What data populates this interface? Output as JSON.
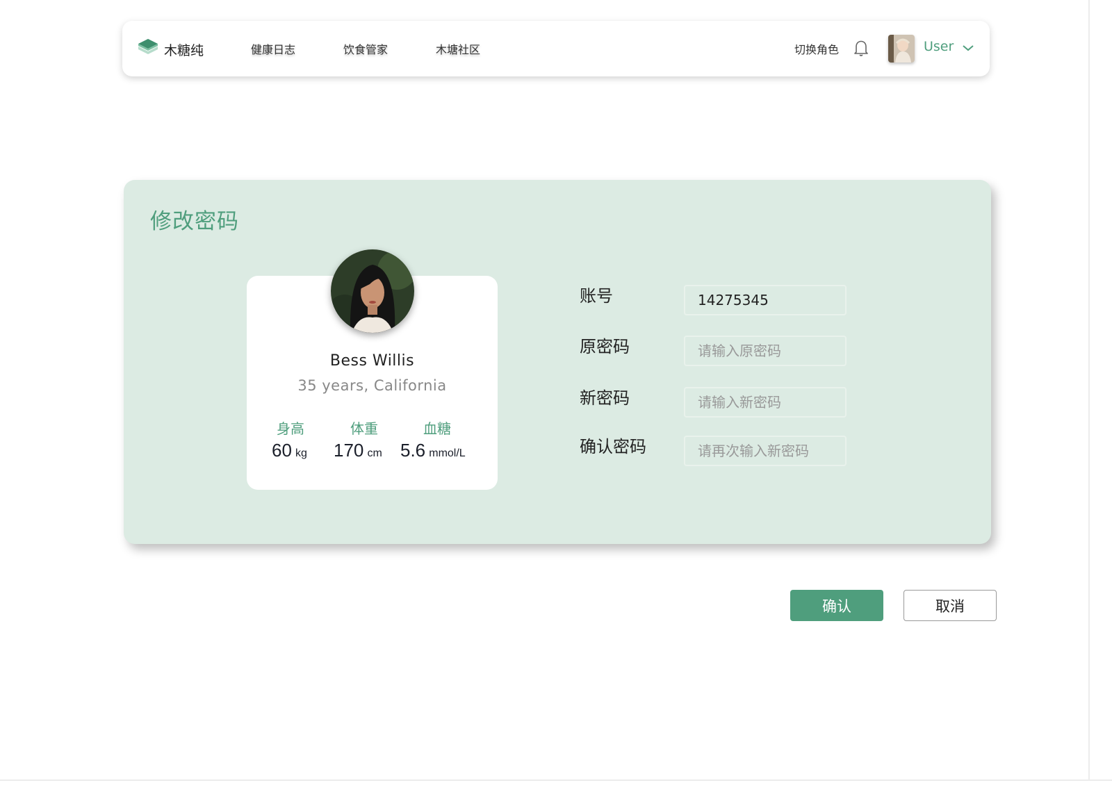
{
  "nav": {
    "brand": "木糖纯",
    "links": [
      "健康日志",
      "饮食管家",
      "木塘社区"
    ],
    "switch_role": "切换角色",
    "user_name": "User"
  },
  "panel": {
    "title": "修改密码"
  },
  "profile": {
    "name": "Bess Willis",
    "subtitle": "35 years, California",
    "stats": [
      {
        "label": "身高",
        "value": "60",
        "unit": "kg"
      },
      {
        "label": "体重",
        "value": "170",
        "unit": "cm"
      },
      {
        "label": "血糖",
        "value": "5.6",
        "unit": "mmol/L"
      }
    ]
  },
  "form": {
    "account_label": "账号",
    "account_value": "14275345",
    "old_password_label": "原密码",
    "old_password_placeholder": "请输入原密码",
    "new_password_label": "新密码",
    "new_password_placeholder": "请输入新密码",
    "confirm_password_label": "确认密码",
    "confirm_password_placeholder": "请再次输入新密码"
  },
  "actions": {
    "confirm_label": "确认",
    "cancel_label": "取消"
  },
  "colors": {
    "accent": "#4f9e7d",
    "panel_bg": "#dcebe3"
  }
}
